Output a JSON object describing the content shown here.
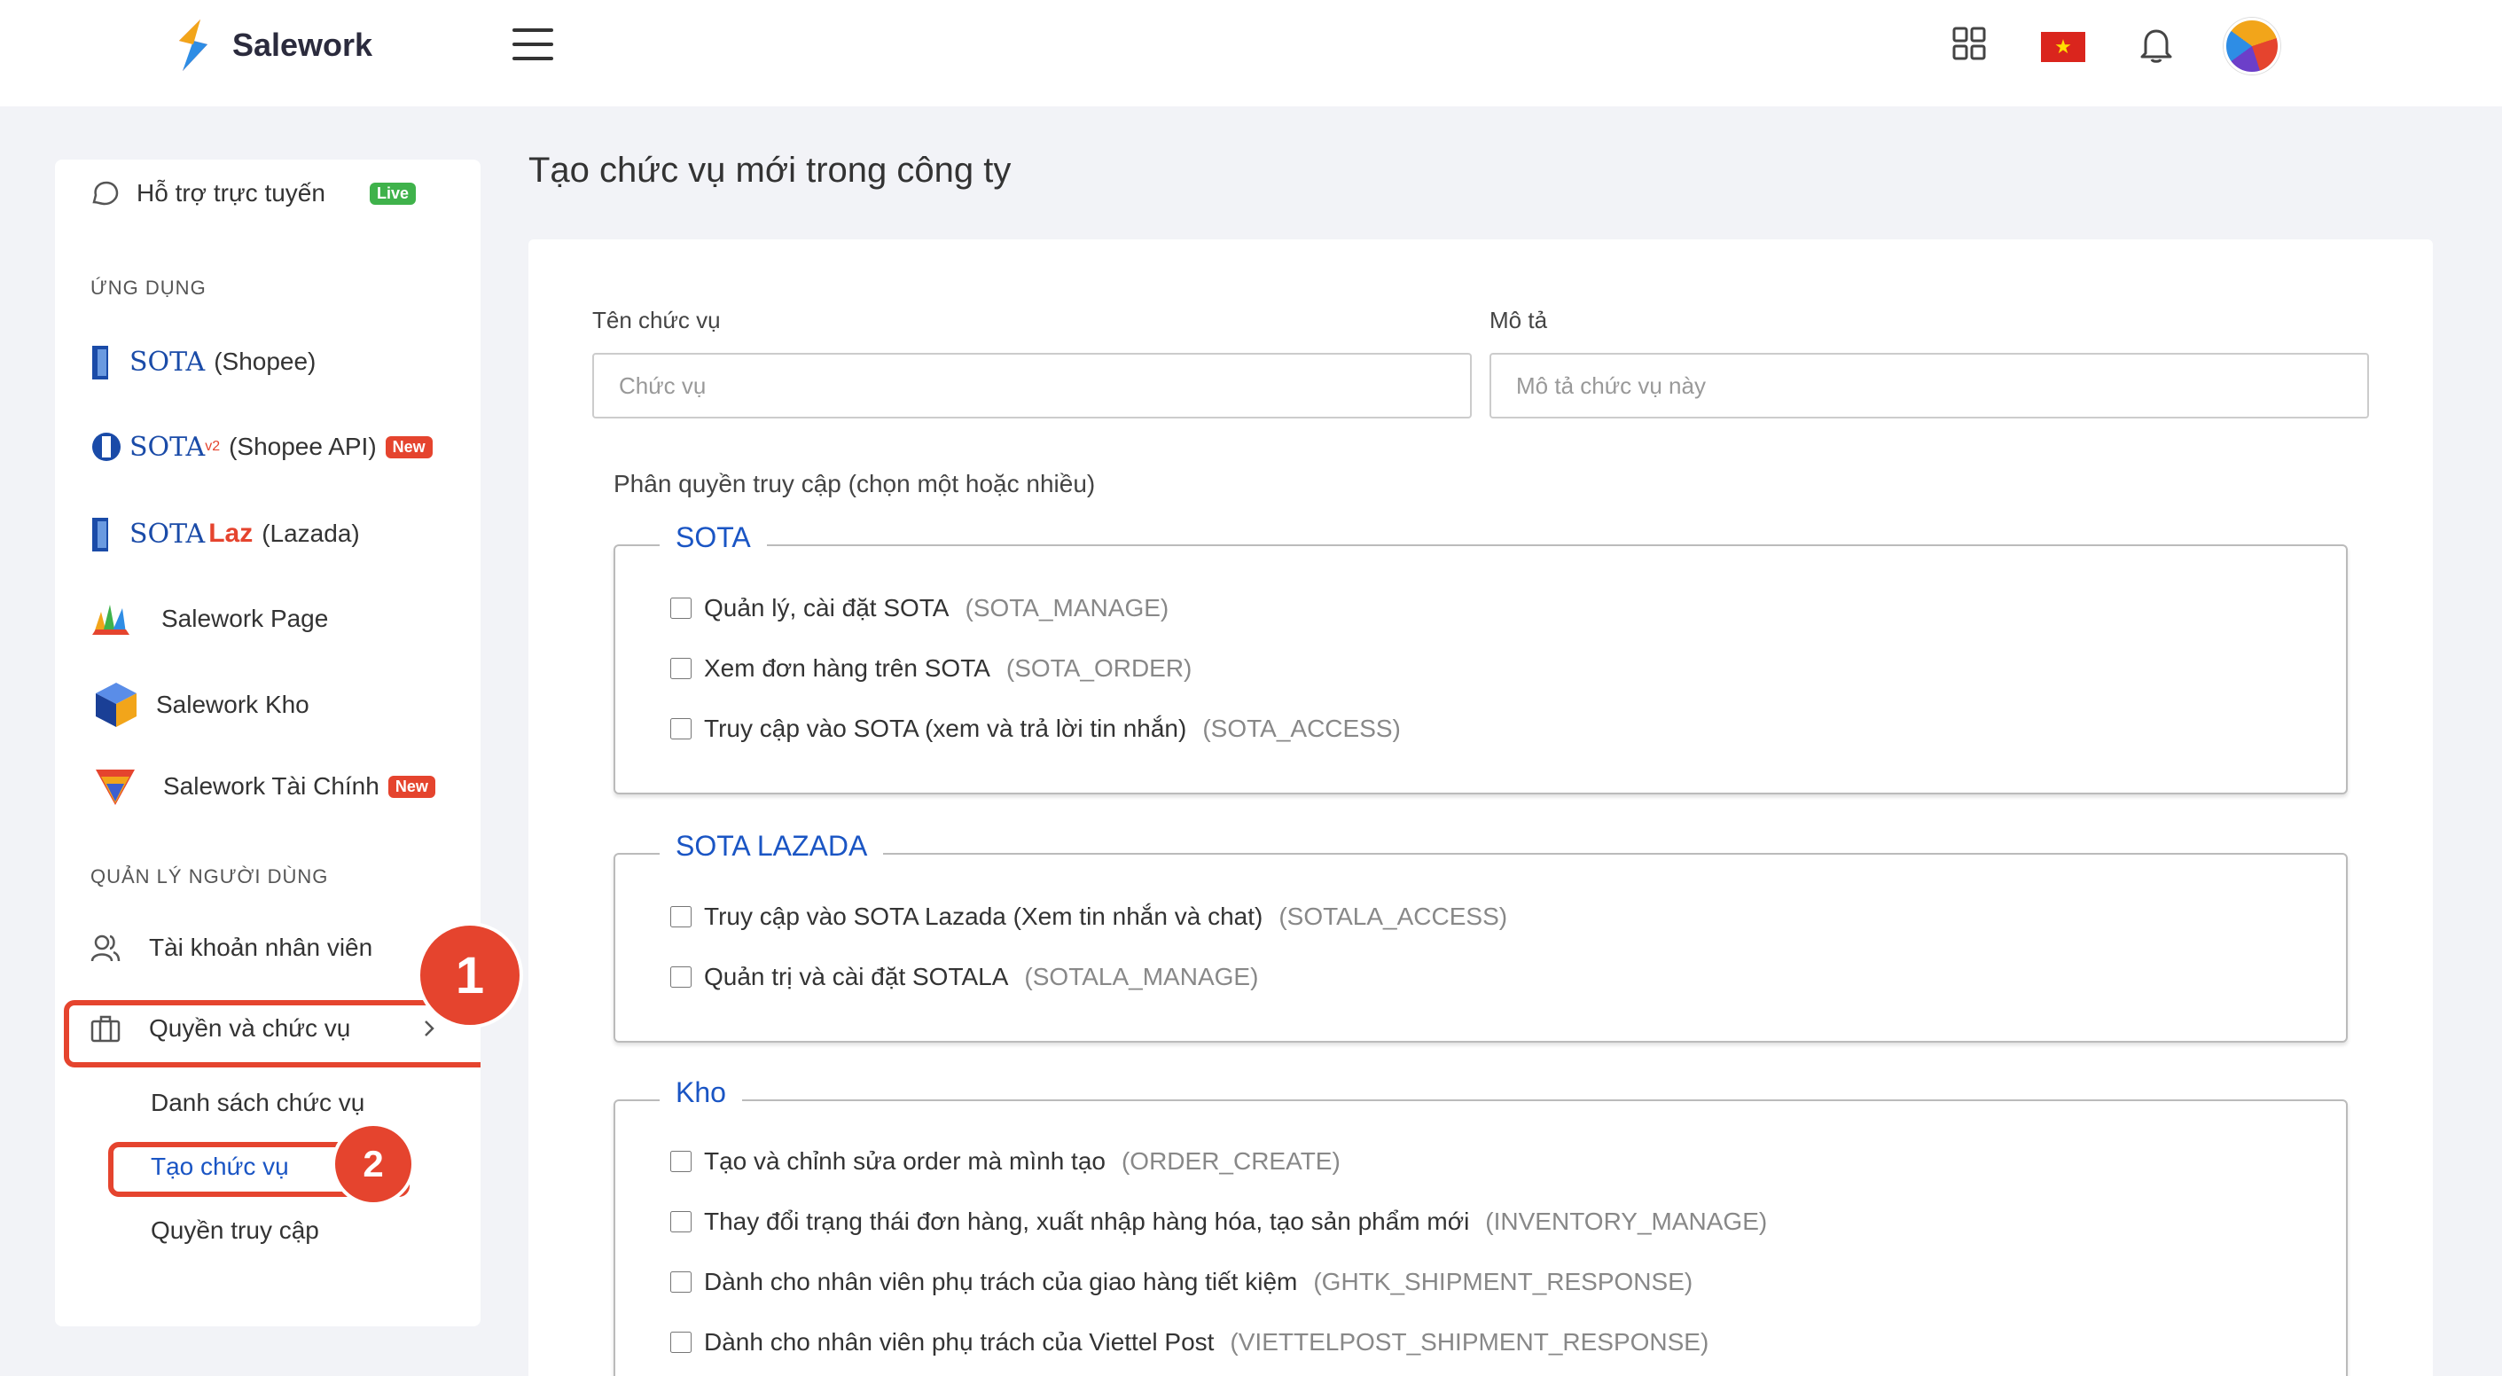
{
  "header": {
    "app_name": "Salework",
    "icons": [
      "menu-icon",
      "apps-grid-icon",
      "vietnam-flag-icon",
      "bell-icon",
      "avatar"
    ]
  },
  "sidebar": {
    "live_support": {
      "label": "Hỗ trợ trực tuyến",
      "badge": "Live"
    },
    "apps_section": "ỨNG DỤNG",
    "apps": [
      {
        "brand": "SOTA",
        "label": "(Shopee)",
        "icon": "sota-shopee-icon"
      },
      {
        "brand": "SOTA",
        "brand_sup": "v2",
        "label": "(Shopee API)",
        "badge": "New",
        "icon": "sota-v2-icon"
      },
      {
        "brand": "SOTA",
        "brand_suffix": "Laz",
        "label": "(Lazada)",
        "icon": "sota-lazada-icon"
      },
      {
        "label": "Salework Page",
        "icon": "salework-page-icon"
      },
      {
        "label": "Salework Kho",
        "icon": "salework-kho-icon"
      },
      {
        "label": "Salework Tài Chính",
        "badge": "New",
        "icon": "salework-finance-icon"
      }
    ],
    "users_section": "QUẢN LÝ NGƯỜI DÙNG",
    "staff_accounts": "Tài khoản nhân viên",
    "roles": "Quyền và chức vụ",
    "sub_items": [
      "Danh sách chức vụ",
      "Tạo chức vụ",
      "Quyền truy cập"
    ],
    "step_markers": [
      "1",
      "2"
    ]
  },
  "main": {
    "title": "Tạo chức vụ mới trong công ty",
    "name_label": "Tên chức vụ",
    "name_placeholder": "Chức vụ",
    "desc_label": "Mô tả",
    "desc_placeholder": "Mô tả chức vụ này",
    "perm_label": "Phân quyền truy cập (chọn một hoặc nhiều)",
    "groups": [
      {
        "title": "SOTA",
        "items": [
          {
            "label": "Quản lý, cài đặt SOTA",
            "code": "(SOTA_MANAGE)"
          },
          {
            "label": "Xem đơn hàng trên SOTA",
            "code": "(SOTA_ORDER)"
          },
          {
            "label": "Truy cập vào SOTA (xem và trả lời tin nhắn)",
            "code": "(SOTA_ACCESS)"
          }
        ]
      },
      {
        "title": "SOTA LAZADA",
        "items": [
          {
            "label": "Truy cập vào SOTA Lazada (Xem tin nhắn và chat)",
            "code": "(SOTALA_ACCESS)"
          },
          {
            "label": "Quản trị và cài đặt SOTALA",
            "code": "(SOTALA_MANAGE)"
          }
        ]
      },
      {
        "title": "Kho",
        "items": [
          {
            "label": "Tạo và chỉnh sửa order mà mình tạo",
            "code": "(ORDER_CREATE)"
          },
          {
            "label": "Thay đổi trạng thái đơn hàng, xuất nhập hàng hóa, tạo sản phẩm mới",
            "code": "(INVENTORY_MANAGE)"
          },
          {
            "label": "Dành cho nhân viên phụ trách của giao hàng tiết kiệm",
            "code": "(GHTK_SHIPMENT_RESPONSE)"
          },
          {
            "label": "Dành cho nhân viên phụ trách của Viettel Post",
            "code": "(VIETTELPOST_SHIPMENT_RESPONSE)"
          }
        ]
      }
    ]
  },
  "colors": {
    "accent": "#1a55c4",
    "highlight": "#e5442e",
    "live": "#3fb24b"
  }
}
